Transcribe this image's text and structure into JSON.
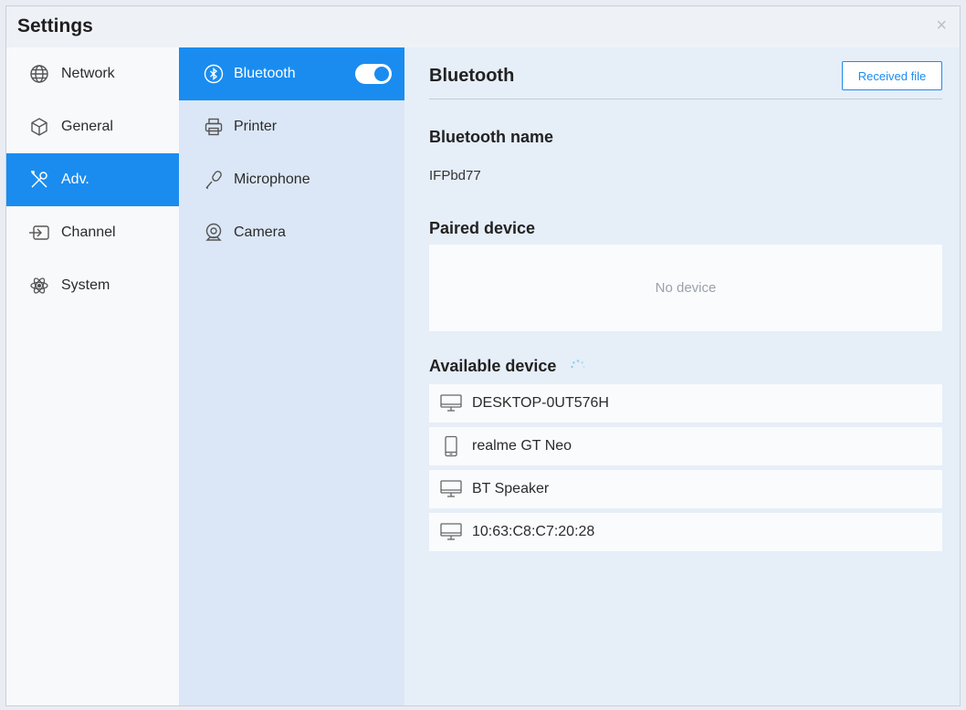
{
  "window": {
    "title": "Settings",
    "close_glyph": "×"
  },
  "sidebar": {
    "items": [
      {
        "label": "Network",
        "icon": "globe-icon",
        "active": false
      },
      {
        "label": "General",
        "icon": "cube-icon",
        "active": false
      },
      {
        "label": "Adv.",
        "icon": "tools-icon",
        "active": true
      },
      {
        "label": "Channel",
        "icon": "input-icon",
        "active": false
      },
      {
        "label": "System",
        "icon": "atom-icon",
        "active": false
      }
    ]
  },
  "submenu": {
    "items": [
      {
        "label": "Bluetooth",
        "icon": "bluetooth-icon",
        "active": true,
        "toggle_on": true
      },
      {
        "label": "Printer",
        "icon": "printer-icon",
        "active": false
      },
      {
        "label": "Microphone",
        "icon": "microphone-icon",
        "active": false
      },
      {
        "label": "Camera",
        "icon": "camera-icon",
        "active": false
      }
    ]
  },
  "panel": {
    "title": "Bluetooth",
    "received_file_label": "Received file",
    "bluetooth_name_heading": "Bluetooth name",
    "bluetooth_name_value": "IFPbd77",
    "paired_heading": "Paired device",
    "paired_empty_text": "No device",
    "available_heading": "Available device",
    "available_devices": [
      {
        "name": "DESKTOP-0UT576H",
        "icon": "monitor-icon"
      },
      {
        "name": "realme GT Neo",
        "icon": "phone-icon"
      },
      {
        "name": "BT Speaker",
        "icon": "monitor-icon"
      },
      {
        "name": "10:63:C8:C7:20:28",
        "icon": "monitor-icon"
      }
    ]
  },
  "colors": {
    "accent": "#1a8cf0",
    "middle_bg": "#dbe7f6",
    "panel_bg": "#e6eef8"
  }
}
